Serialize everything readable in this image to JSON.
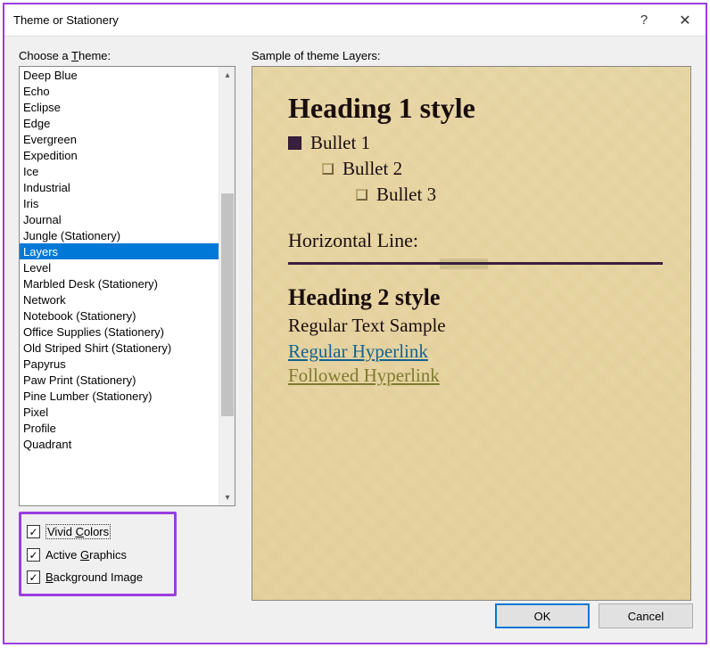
{
  "titlebar": {
    "title": "Theme or Stationery",
    "help_symbol": "?",
    "close_symbol": "✕"
  },
  "left": {
    "choose_label_pre": "Choose a ",
    "choose_label_u": "T",
    "choose_label_post": "heme:",
    "items": [
      "Deep Blue",
      "Echo",
      "Eclipse",
      "Edge",
      "Evergreen",
      "Expedition",
      "Ice",
      "Industrial",
      "Iris",
      "Journal",
      "Jungle (Stationery)",
      "Layers",
      "Level",
      "Marbled Desk (Stationery)",
      "Network",
      "Notebook (Stationery)",
      "Office Supplies (Stationery)",
      "Old Striped Shirt (Stationery)",
      "Papyrus",
      "Paw Print (Stationery)",
      "Pine Lumber (Stationery)",
      "Pixel",
      "Profile",
      "Quadrant"
    ],
    "selected_index": 11,
    "checkboxes": {
      "vivid_pre": "Vivid ",
      "vivid_u": "C",
      "vivid_post": "olors",
      "active_pre": "Active ",
      "active_u": "G",
      "active_post": "raphics",
      "bg_u": "B",
      "bg_post": "ackground Image",
      "check_mark": "✓"
    }
  },
  "right": {
    "sample_label": "Sample of theme Layers:",
    "preview": {
      "h1": "Heading 1 style",
      "bullet1": "Bullet 1",
      "bullet2": "Bullet 2",
      "bullet3": "Bullet 3",
      "hline_label": "Horizontal Line:",
      "h2": "Heading 2 style",
      "regular_text": "Regular Text Sample",
      "regular_link": "Regular Hyperlink",
      "followed_link": "Followed Hyperlink"
    }
  },
  "footer": {
    "ok": "OK",
    "cancel": "Cancel"
  }
}
